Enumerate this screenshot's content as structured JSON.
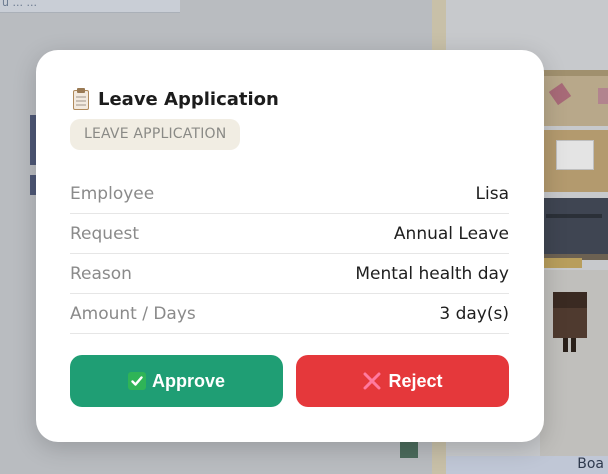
{
  "background": {
    "top_left_text": "u ... ...",
    "bottom_right_text": "Boa"
  },
  "modal": {
    "icon": "clipboard-icon",
    "title": "Leave Application",
    "badge": "LEAVE APPLICATION",
    "details": [
      {
        "label": "Employee",
        "value": "Lisa"
      },
      {
        "label": "Request",
        "value": "Annual Leave"
      },
      {
        "label": "Reason",
        "value": "Mental health day"
      },
      {
        "label": "Amount / Days",
        "value": "3 day(s)"
      }
    ],
    "approve_label": "Approve",
    "approve_icon": "check-box-icon",
    "reject_label": "Reject",
    "reject_icon": "x-icon",
    "colors": {
      "approve": "#1f9e74",
      "reject": "#e5383b",
      "badge_bg": "#f1ede3"
    }
  }
}
